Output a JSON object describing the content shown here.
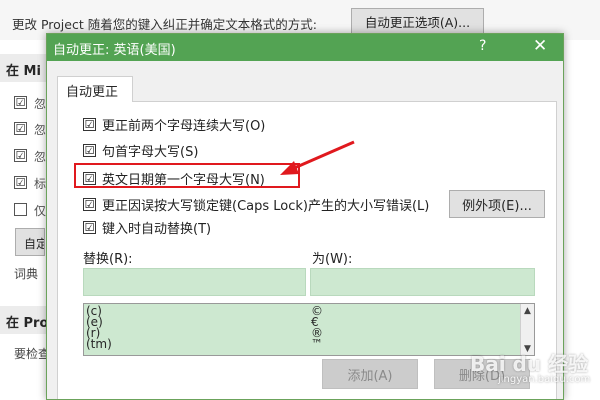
{
  "background": {
    "top_text": "更改 Project 随着您的键入纠正并确定文本格式的方式:",
    "autocorrect_options_button": "自动更正选项(A)...",
    "section1_title": "在 Mi",
    "checkbox_texts": [
      "忽",
      "忽",
      "忽",
      "标",
      "仅"
    ],
    "checkbox_states": [
      "☑",
      "☑",
      "☑",
      "☑",
      ""
    ],
    "small_button": "自定",
    "dictionary_text": "词典",
    "section2_title": "在 Pro",
    "check_text": "要检查"
  },
  "dialog": {
    "title": "自动更正: 英语(美国)",
    "help": "?",
    "close": "✕",
    "tab_label": "自动更正",
    "options": [
      {
        "checked": "☑",
        "label": "更正前两个字母连续大写(O)"
      },
      {
        "checked": "☑",
        "label": "句首字母大写(S)"
      },
      {
        "checked": "☑",
        "label": "英文日期第一个字母大写(N)"
      },
      {
        "checked": "☑",
        "label": "更正因误按大写锁定键(Caps Lock)产生的大小写错误(L)"
      },
      {
        "checked": "☑",
        "label": "键入时自动替换(T)"
      }
    ],
    "exceptions_button": "例外项(E)...",
    "replace_label": "替换(R):",
    "with_label": "为(W):",
    "replace_value": "",
    "with_value": "",
    "list_rows": [
      {
        "replace": "(c)",
        "with": "©"
      },
      {
        "replace": "(e)",
        "with": "€"
      },
      {
        "replace": "(r)",
        "with": "®"
      },
      {
        "replace": "(tm)",
        "with": "™"
      },
      {
        "replace": "...",
        "with": "…"
      }
    ],
    "add_button": "添加(A)",
    "delete_button": "删除(D)"
  },
  "annotation": {
    "color": "#e0191e"
  },
  "watermark": {
    "text": "Bai du 经验",
    "sub": "jingyan.baidu.com"
  },
  "colors": {
    "titlebar": "#53a353",
    "field": "#cde8d0"
  }
}
